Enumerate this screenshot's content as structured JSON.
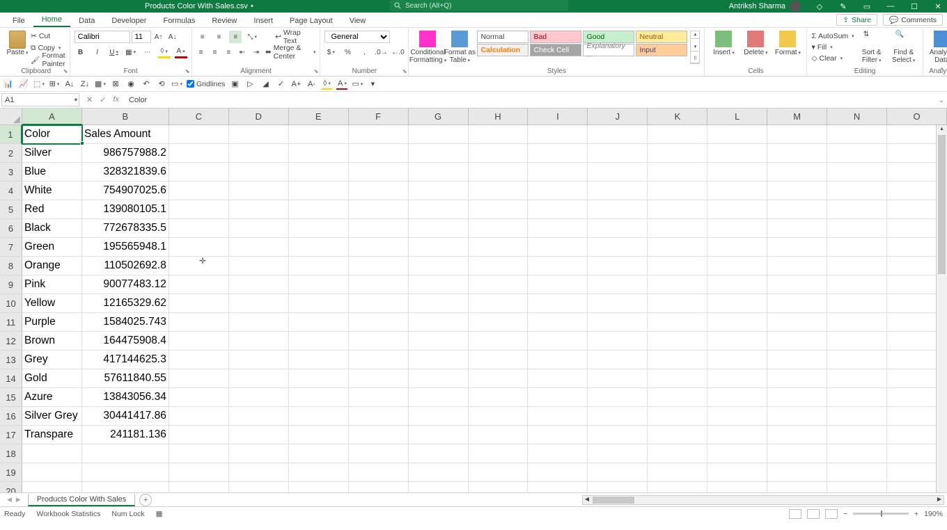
{
  "title": "Products Color With Sales.csv",
  "search_placeholder": "Search (Alt+Q)",
  "user": "Antriksh Sharma",
  "top_buttons": {
    "share": "Share",
    "comments": "Comments"
  },
  "tabs": [
    "File",
    "Home",
    "Data",
    "Developer",
    "Formulas",
    "Review",
    "Insert",
    "Page Layout",
    "View"
  ],
  "active_tab": "Home",
  "ribbon": {
    "clipboard": {
      "paste": "Paste",
      "cut": "Cut",
      "copy": "Copy",
      "painter": "Format Painter",
      "label": "Clipboard"
    },
    "font": {
      "name": "Calibri",
      "size": "11",
      "bold": "B",
      "italic": "I",
      "underline": "U",
      "label": "Font"
    },
    "alignment": {
      "wrap": "Wrap Text",
      "merge": "Merge & Center",
      "label": "Alignment"
    },
    "number": {
      "format": "General",
      "label": "Number"
    },
    "styles": {
      "cond": "Conditional Formatting",
      "table": "Format as Table",
      "normal": "Normal",
      "bad": "Bad",
      "good": "Good",
      "neutral": "Neutral",
      "calc": "Calculation",
      "check": "Check Cell",
      "expl": "Explanatory ...",
      "input": "Input",
      "label": "Styles"
    },
    "cells": {
      "insert": "Insert",
      "delete": "Delete",
      "format": "Format",
      "label": "Cells"
    },
    "editing": {
      "autosum": "AutoSum",
      "fill": "Fill",
      "clear": "Clear",
      "sort": "Sort & Filter",
      "find": "Find & Select",
      "label": "Editing"
    },
    "analysis": {
      "analyze": "Analyze Data",
      "label": "Analysis"
    }
  },
  "qat": {
    "gridlines": "Gridlines"
  },
  "name_box": "A1",
  "formula": "Color",
  "columns": [
    "A",
    "B",
    "C",
    "D",
    "E",
    "F",
    "G",
    "H",
    "I",
    "J",
    "K",
    "L",
    "M",
    "N",
    "O"
  ],
  "rows": [
    "1",
    "2",
    "3",
    "4",
    "5",
    "6",
    "7",
    "8",
    "9",
    "10",
    "11",
    "12",
    "13",
    "14",
    "15",
    "16",
    "17",
    "18",
    "19",
    "20"
  ],
  "data": [
    [
      "Color",
      "Sales Amount"
    ],
    [
      "Silver",
      "986757988.2"
    ],
    [
      "Blue",
      "328321839.6"
    ],
    [
      "White",
      "754907025.6"
    ],
    [
      "Red",
      "139080105.1"
    ],
    [
      "Black",
      "772678335.5"
    ],
    [
      "Green",
      "195565948.1"
    ],
    [
      "Orange",
      "110502692.8"
    ],
    [
      "Pink",
      "90077483.12"
    ],
    [
      "Yellow",
      "12165329.62"
    ],
    [
      "Purple",
      "1584025.743"
    ],
    [
      "Brown",
      "164475908.4"
    ],
    [
      "Grey",
      "417144625.3"
    ],
    [
      "Gold",
      "57611840.55"
    ],
    [
      "Azure",
      "13843056.34"
    ],
    [
      "Silver Grey",
      "30441417.86"
    ],
    [
      "Transpare",
      "241181.136"
    ]
  ],
  "sheet_tab": "Products Color With Sales",
  "status": {
    "ready": "Ready",
    "wb_stats": "Workbook Statistics",
    "numlock": "Num Lock",
    "zoom": "190%"
  }
}
